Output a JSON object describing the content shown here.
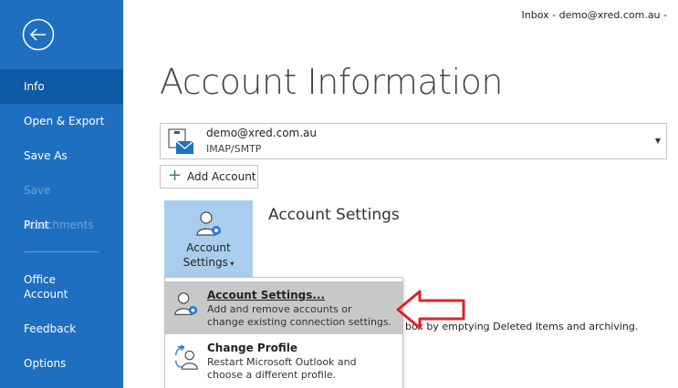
{
  "window": {
    "title": "Inbox - demo@xred.com.au  -"
  },
  "sidebar": {
    "items": [
      {
        "label": "Info",
        "state": "active"
      },
      {
        "label": "Open & Export",
        "state": "normal"
      },
      {
        "label": "Save As",
        "state": "normal"
      },
      {
        "label": "Save Attachments",
        "state": "disabled"
      },
      {
        "label": "Print",
        "state": "normal"
      },
      {
        "label": "Office\nAccount",
        "state": "normal"
      },
      {
        "label": "Feedback",
        "state": "normal"
      },
      {
        "label": "Options",
        "state": "normal"
      }
    ]
  },
  "main": {
    "title": "Account Information",
    "account": {
      "email": "demo@xred.com.au",
      "type": "IMAP/SMTP"
    },
    "add_account_label": "Add Account",
    "settings_tile": {
      "line1": "Account",
      "line2": "Settings"
    },
    "settings_heading": "Account Settings",
    "behind_text": "box by emptying Deleted Items and archiving."
  },
  "dropdown": {
    "items": [
      {
        "title": "Account Settings...",
        "desc_line1": "Add and remove accounts or",
        "desc_line2": "change existing connection settings.",
        "icon": "account-gear-icon",
        "highlighted": true
      },
      {
        "title": "Change Profile",
        "desc_line1": "Restart Microsoft Outlook and",
        "desc_line2": "choose a different profile.",
        "icon": "change-profile-icon",
        "highlighted": false
      }
    ]
  },
  "colors": {
    "sidebar": "#1e6fc0",
    "sidebar_active": "#0f5aa6",
    "tile": "#a9cdec",
    "menu_highlight": "#c8c8c8",
    "arrow": "#e0202a"
  }
}
